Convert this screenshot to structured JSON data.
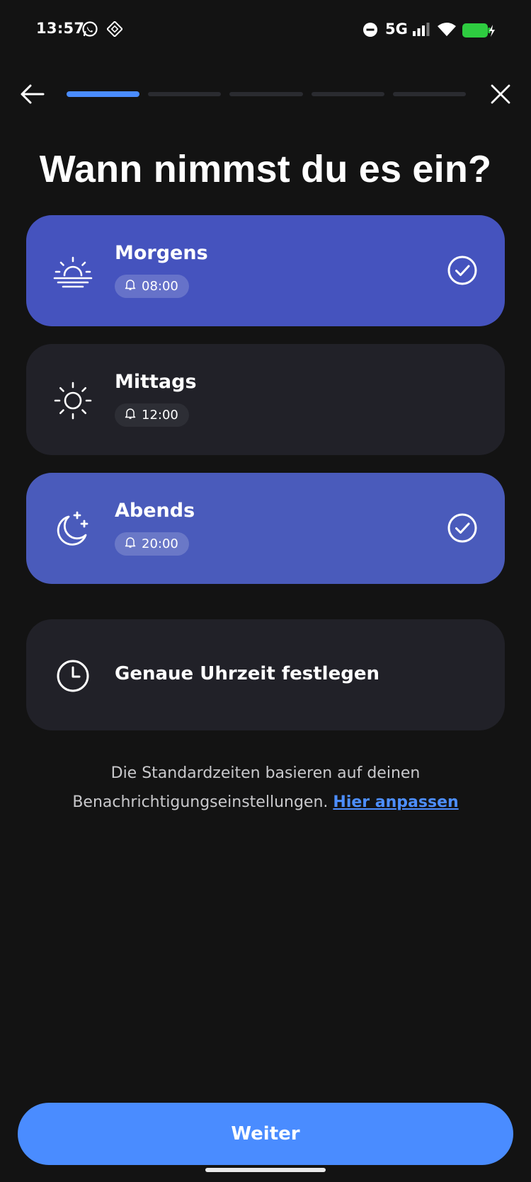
{
  "status_bar": {
    "time": "13:57",
    "network": "5G",
    "icons": [
      "whatsapp-icon",
      "app-notification-icon",
      "do-not-disturb-icon",
      "signal-icon",
      "wifi-icon",
      "battery-charging-icon"
    ],
    "battery_color": "#2ecc40"
  },
  "nav": {
    "back_icon": "arrow-left-icon",
    "close_icon": "close-icon",
    "progress": {
      "steps": 5,
      "current": 1
    }
  },
  "title": "Wann nimmst du es ein?",
  "options": [
    {
      "label": "Morgens",
      "time": "08:00",
      "icon": "sunrise-icon",
      "selected": true
    },
    {
      "label": "Mittags",
      "time": "12:00",
      "icon": "sun-icon",
      "selected": false
    },
    {
      "label": "Abends",
      "time": "20:00",
      "icon": "moon-stars-icon",
      "selected": true
    }
  ],
  "exact_time": {
    "label": "Genaue Uhrzeit festlegen",
    "icon": "clock-icon"
  },
  "info": {
    "line1": "Die Standardzeiten basieren auf deinen",
    "line2": "Benachrichtigungseinstellungen.",
    "link": "Hier anpassen"
  },
  "continue_label": "Weiter",
  "colors": {
    "background": "#131313",
    "accent": "#4a8cff",
    "selected_card": "#4553be",
    "card": "#212128"
  }
}
